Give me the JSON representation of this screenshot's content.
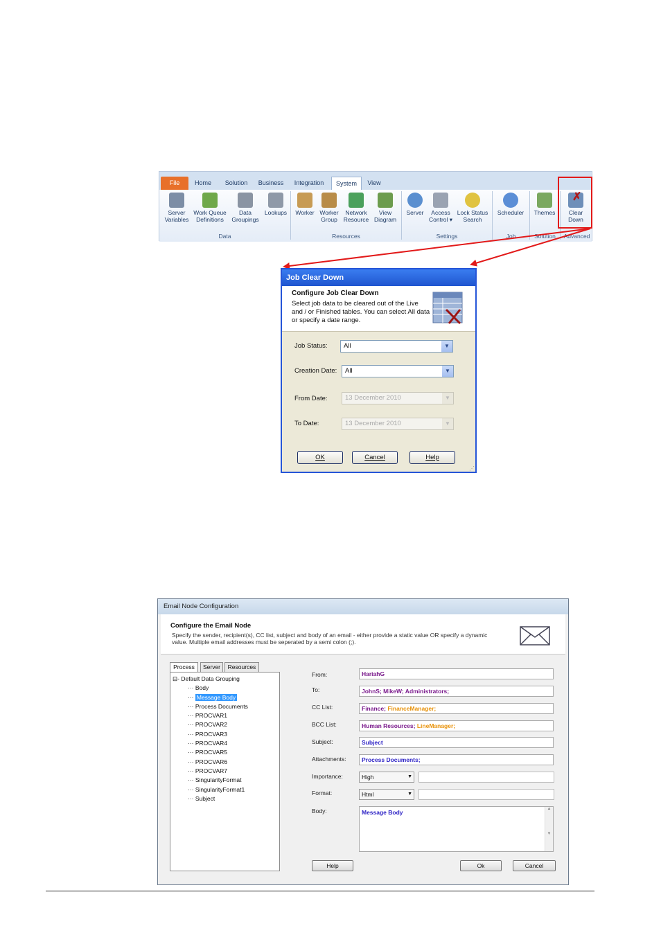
{
  "ribbon": {
    "tabs": [
      "File",
      "Home",
      "Solution",
      "Business",
      "Integration",
      "System",
      "View"
    ],
    "active_tab": "System",
    "buttons": [
      {
        "label1": "Server",
        "label2": "Variables",
        "icon": "server-variables-icon",
        "color": "#7d8ea6"
      },
      {
        "label1": "Work Queue",
        "label2": "Definitions",
        "icon": "work-queue-icon",
        "color": "#6fa84a"
      },
      {
        "label1": "Data",
        "label2": "Groupings",
        "icon": "data-groupings-icon",
        "color": "#8a94a3"
      },
      {
        "label1": "Lookups",
        "label2": "",
        "icon": "lookups-icon",
        "color": "#8f99a8"
      },
      {
        "label1": "Worker",
        "label2": "",
        "icon": "worker-icon",
        "color": "#c79b54"
      },
      {
        "label1": "Worker",
        "label2": "Group",
        "icon": "worker-group-icon",
        "color": "#b88c48"
      },
      {
        "label1": "Network",
        "label2": "Resource",
        "icon": "network-resource-icon",
        "color": "#4aa05c"
      },
      {
        "label1": "View",
        "label2": "Diagram",
        "icon": "view-diagram-icon",
        "color": "#6c9c4e"
      },
      {
        "label1": "Server",
        "label2": "",
        "icon": "server-gear-icon",
        "color": "#5a8fd0"
      },
      {
        "label1": "Access",
        "label2": "Control ▾",
        "icon": "access-control-icon",
        "color": "#9aa3b2"
      },
      {
        "label1": "Lock Status",
        "label2": "Search",
        "icon": "lock-status-icon",
        "color": "#e0c341"
      },
      {
        "label1": "Scheduler",
        "label2": "",
        "icon": "scheduler-icon",
        "color": "#5b8ed6"
      },
      {
        "label1": "Themes",
        "label2": "",
        "icon": "themes-icon",
        "color": "#7aa860"
      },
      {
        "label1": "Clear",
        "label2": "Down",
        "icon": "clear-down-icon",
        "color": "#6e8fb9"
      }
    ],
    "groups": [
      "Data",
      "Resources",
      "Settings",
      "Job",
      "Solution",
      "Advanced"
    ]
  },
  "job_clear_down": {
    "title": "Job Clear Down",
    "heading": "Configure Job Clear Down",
    "description": "Select job data to be cleared out of the Live and / or Finished tables. You can select All data or specify a date range.",
    "job_status_label": "Job Status:",
    "job_status_value": "All",
    "creation_date_label": "Creation Date:",
    "creation_date_value": "All",
    "from_date_label": "From Date:",
    "from_date_value": "13 December 2010",
    "to_date_label": "To Date:",
    "to_date_value": "13 December 2010",
    "ok_label": "OK",
    "cancel_label": "Cancel",
    "help_label": "Help"
  },
  "email_node": {
    "title": "Email Node Configuration",
    "heading": "Configure the Email Node",
    "description": "Specify the sender, recipient(s), CC list, subject and body of an email - either provide a static value OR specify a dynamic value. Multiple email addresses must be seperated by a semi colon (;).",
    "tabs": [
      "Process",
      "Server",
      "Resources"
    ],
    "tree_root": "Default Data Grouping",
    "tree_items": [
      "Body",
      "Message Body",
      "Process Documents",
      "PROCVAR1",
      "PROCVAR2",
      "PROCVAR3",
      "PROCVAR4",
      "PROCVAR5",
      "PROCVAR6",
      "PROCVAR7",
      "SingularityFormat",
      "SingularityFormat1",
      "Subject"
    ],
    "selected_item": "Message Body",
    "labels": {
      "from": "From:",
      "to": "To:",
      "cc": "CC List:",
      "bcc": "BCC List:",
      "subject": "Subject:",
      "attachments": "Attachments:",
      "importance": "Importance:",
      "format": "Format:",
      "body": "Body:"
    },
    "values": {
      "from": "HariahG",
      "to": "JohnS; MikeW; Administrators;",
      "cc_a": "Finance;",
      "cc_b": "FinanceManager;",
      "bcc_a": "Human Resources;",
      "bcc_b": "LineManager;",
      "subject": "Subject",
      "attachments": "Process Documents;",
      "importance": "High",
      "format": "Html",
      "body": "Message Body"
    },
    "help_label": "Help",
    "ok_label": "Ok",
    "cancel_label": "Cancel"
  },
  "colors": {
    "highlight": "#e21a1a",
    "dialog_border": "#2555d8",
    "dynamic_value": "#7a1a8c",
    "static_value": "#2a1fc4",
    "mixed_value": "#e8920a"
  }
}
